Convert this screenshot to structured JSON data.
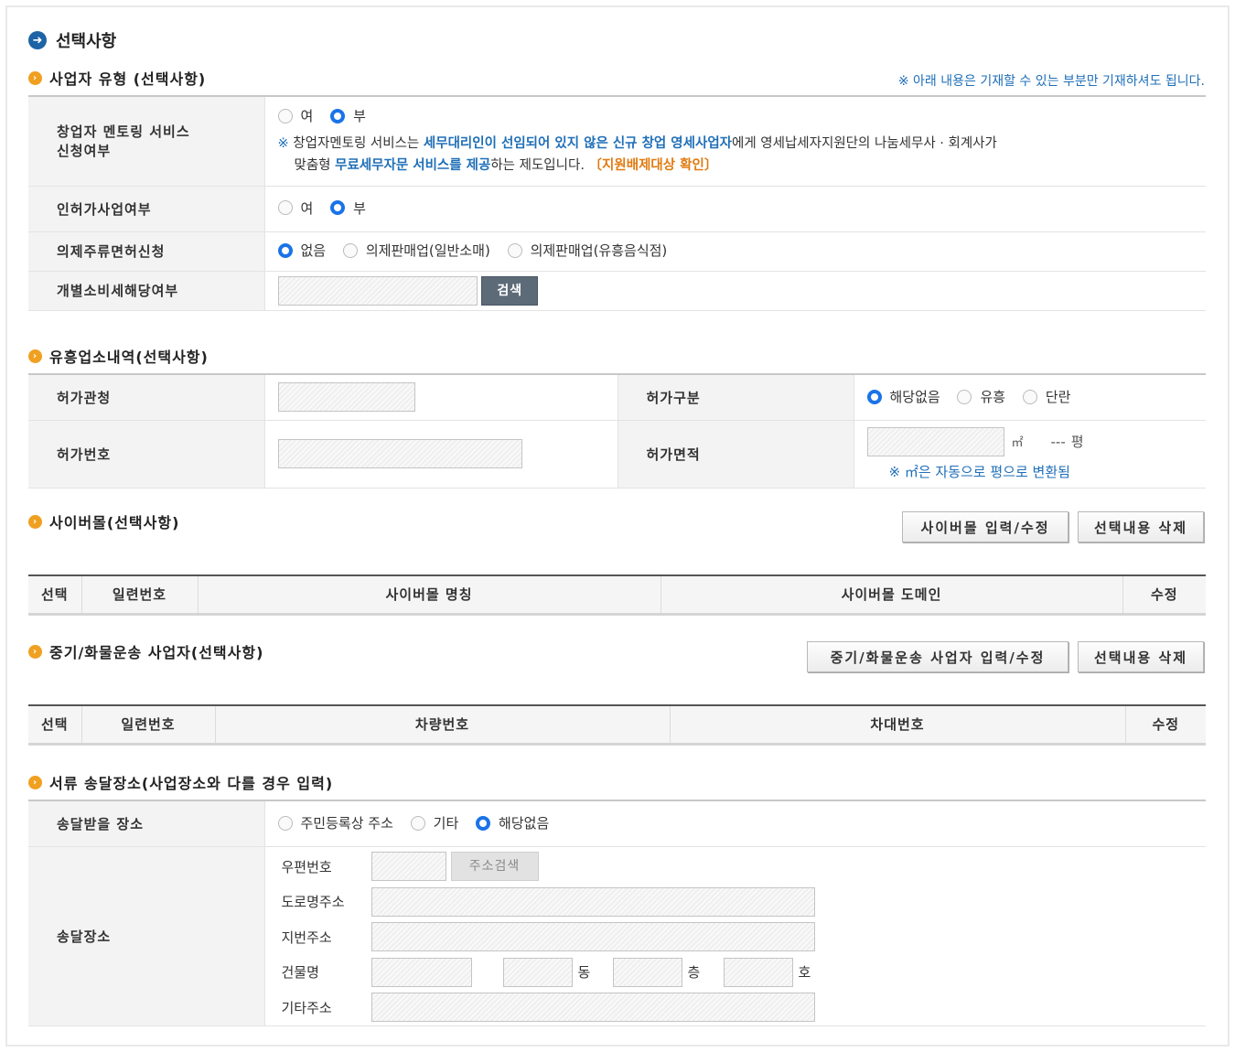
{
  "main_title": "선택사항",
  "business_type": {
    "title": "사업자 유형 (선택사항)",
    "note": "※ 아래 내용은 기재할 수 있는 부분만 기재하셔도 됩니다.",
    "mentoring": {
      "label_line1": "창업자 멘토링 서비스",
      "label_line2": "신청여부",
      "opt_yes": "여",
      "opt_no": "부",
      "selected": "부",
      "desc_mark": "※",
      "desc_1": "창업자멘토링 서비스는 ",
      "desc_2": "세무대리인이 선임되어 있지 않은 신규 창업 영세사업자",
      "desc_3": "에게 영세납세자지원단의 나눔세무사 · 회계사가",
      "desc_4": "맞춤형 ",
      "desc_5": "무료세무자문 서비스를 제공",
      "desc_6": "하는 제도입니다.",
      "desc_link": "〔지원배제대상 확인〕"
    },
    "license_biz": {
      "label": "인허가사업여부",
      "opt_yes": "여",
      "opt_no": "부",
      "selected": "부"
    },
    "liquor": {
      "label": "의제주류면허신청",
      "opt_none": "없음",
      "opt_general": "의제판매업(일반소매)",
      "opt_entertain": "의제판매업(유흥음식점)",
      "selected": "없음"
    },
    "excise": {
      "label": "개별소비세해당여부",
      "search_btn": "검색"
    }
  },
  "entertainment": {
    "title": "유흥업소내역(선택사항)",
    "permit_office_label": "허가관청",
    "permit_type_label": "허가구분",
    "permit_type_opts": [
      "해당없음",
      "유흥",
      "단란"
    ],
    "permit_type_selected": "해당없음",
    "permit_no_label": "허가번호",
    "permit_area_label": "허가면적",
    "area_unit": "㎡",
    "pyeong_value": "---",
    "pyeong_unit": "평",
    "area_note": "※ ㎡은 자동으로 평으로 변환됨"
  },
  "cybermall": {
    "title": "사이버몰(선택사항)",
    "btn_edit": "사이버몰 입력/수정",
    "btn_delete": "선택내용 삭제",
    "columns": [
      "선택",
      "일련번호",
      "사이버몰 명칭",
      "사이버몰 도메인",
      "수정"
    ]
  },
  "transport": {
    "title": "중기/화물운송 사업자(선택사항)",
    "btn_edit": "중기/화물운송 사업자 입력/수정",
    "btn_delete": "선택내용 삭제",
    "columns": [
      "선택",
      "일련번호",
      "차량번호",
      "차대번호",
      "수정"
    ]
  },
  "delivery": {
    "title": "서류 송달장소(사업장소와 다를 경우 입력)",
    "place_label": "송달받을 장소",
    "place_opts": [
      "주민등록상 주소",
      "기타",
      "해당없음"
    ],
    "place_selected": "해당없음",
    "address_label": "송달장소",
    "zip_label": "우편번호",
    "zip_btn": "주소검색",
    "road_label": "도로명주소",
    "lot_label": "지번주소",
    "building_label": "건물명",
    "dong_unit": "동",
    "floor_unit": "층",
    "ho_unit": "호",
    "etc_label": "기타주소"
  }
}
